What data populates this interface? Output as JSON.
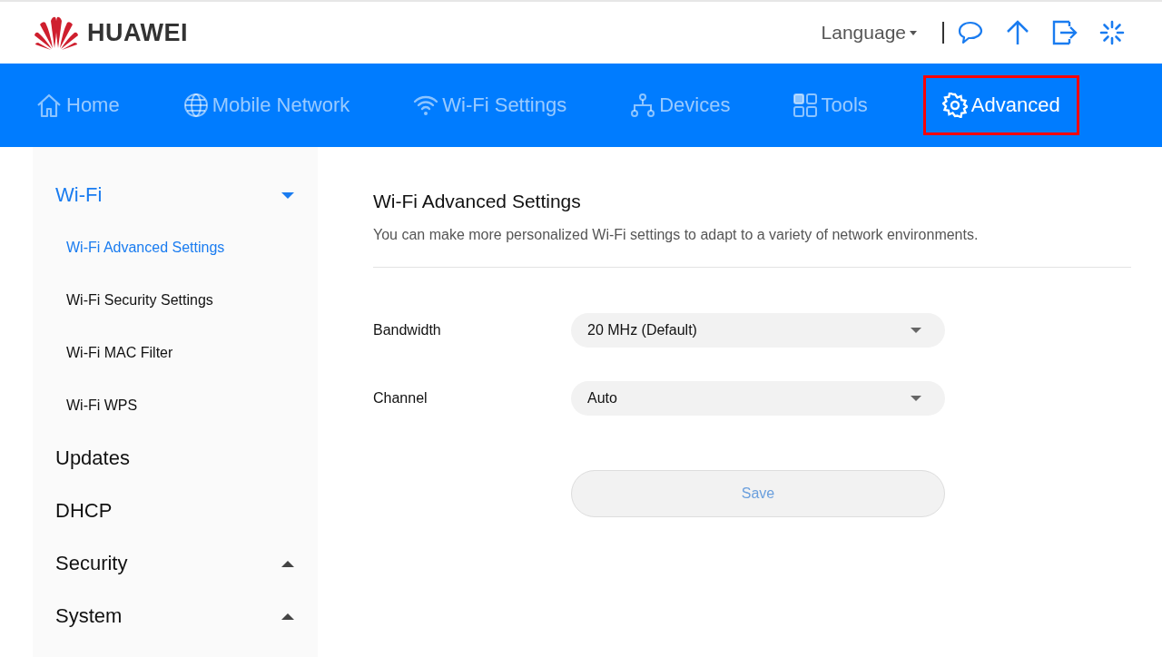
{
  "header": {
    "brand": "HUAWEI",
    "language": "Language"
  },
  "nav": [
    {
      "label": "Home",
      "selected": false
    },
    {
      "label": "Mobile Network",
      "selected": false
    },
    {
      "label": "Wi-Fi Settings",
      "selected": false
    },
    {
      "label": "Devices",
      "selected": false
    },
    {
      "label": "Tools",
      "selected": false
    },
    {
      "label": "Advanced",
      "selected": true
    }
  ],
  "sidebar": [
    {
      "label": "Wi-Fi",
      "expanded": true,
      "selected": true,
      "children": [
        {
          "label": "Wi-Fi Advanced Settings",
          "selected": true
        },
        {
          "label": "Wi-Fi Security Settings",
          "selected": false
        },
        {
          "label": "Wi-Fi MAC Filter",
          "selected": false
        },
        {
          "label": "Wi-Fi WPS",
          "selected": false
        }
      ]
    },
    {
      "label": "Updates",
      "selected": false
    },
    {
      "label": "DHCP",
      "selected": false
    },
    {
      "label": "Security",
      "expanded": false,
      "selected": false
    },
    {
      "label": "System",
      "expanded": false,
      "selected": false
    }
  ],
  "content": {
    "title": "Wi-Fi Advanced Settings",
    "description": "You can make more personalized Wi-Fi settings to adapt to a variety of network environments.",
    "fields": [
      {
        "label": "Bandwidth",
        "value": "20 MHz (Default)"
      },
      {
        "label": "Channel",
        "value": "Auto"
      }
    ],
    "save": {
      "label": "Save",
      "disabled": true
    }
  }
}
